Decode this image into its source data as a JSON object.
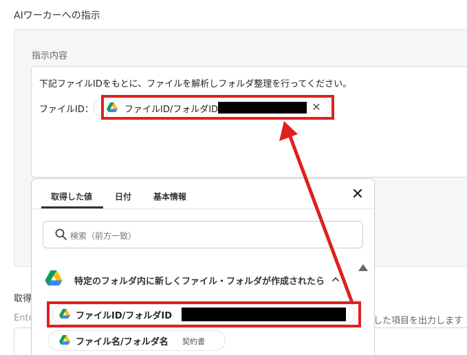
{
  "section": {
    "title": "AIワーカーへの指示"
  },
  "instruction": {
    "label": "指示内容",
    "line1": "下記ファイルIDをもとに、ファイルを解析しフォルダ整理を行ってください。",
    "file_id_label": "ファイルID：",
    "chip": {
      "label": "ファイルID/フォルダID",
      "icon": "google-drive-icon",
      "remove_icon": "close-icon"
    }
  },
  "background": {
    "label2": "取得",
    "enter_text": "Ente",
    "right_text": "した項目を出力します"
  },
  "popup": {
    "tabs": [
      "取得した値",
      "日付",
      "基本情報"
    ],
    "active_tab": "取得した値",
    "search": {
      "placeholder": "検索（前方一致）"
    },
    "group": {
      "title": "特定のフォルダ内に新しくファイル・フォルダが作成されたら"
    },
    "items": [
      {
        "label": "ファイルID/フォルダID",
        "value": ""
      },
      {
        "label": "ファイル名/フォルダ名",
        "value": "契約書"
      }
    ]
  },
  "colors": {
    "highlight": "#e02020",
    "panel_bg": "#f5f6f7"
  }
}
